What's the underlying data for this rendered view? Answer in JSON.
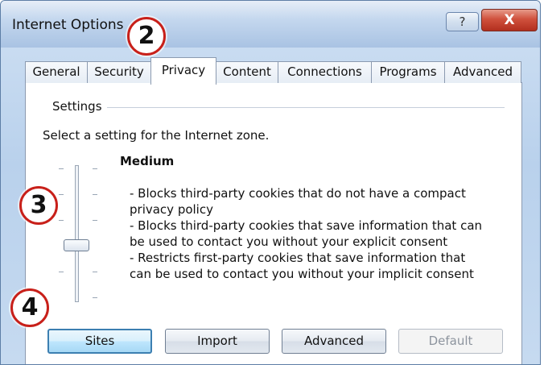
{
  "window": {
    "title": "Internet Options",
    "help_icon": "?",
    "close_icon": "X"
  },
  "tabs": [
    {
      "label": "General",
      "active": false
    },
    {
      "label": "Security",
      "active": false
    },
    {
      "label": "Privacy",
      "active": true
    },
    {
      "label": "Content",
      "active": false
    },
    {
      "label": "Connections",
      "active": false
    },
    {
      "label": "Programs",
      "active": false
    },
    {
      "label": "Advanced",
      "active": false
    }
  ],
  "settings": {
    "group_label": "Settings",
    "instruction": "Select a setting for the Internet zone.",
    "level": "Medium",
    "description": [
      "- Blocks third-party cookies that do not have a compact\nprivacy policy",
      "- Blocks third-party cookies that save information that can\nbe used to contact you without your explicit consent",
      "- Restricts first-party cookies that save information that\ncan be used to contact you without your implicit consent"
    ],
    "slider_level_fraction": 0.5
  },
  "buttons": {
    "sites": "Sites",
    "import": "Import",
    "advanced": "Advanced",
    "default": "Default"
  },
  "callouts": [
    "2",
    "3",
    "4"
  ],
  "colors": {
    "callout_border": "#c8201a",
    "close_button": "#c9442f",
    "focus_border": "#3c7fb1"
  }
}
